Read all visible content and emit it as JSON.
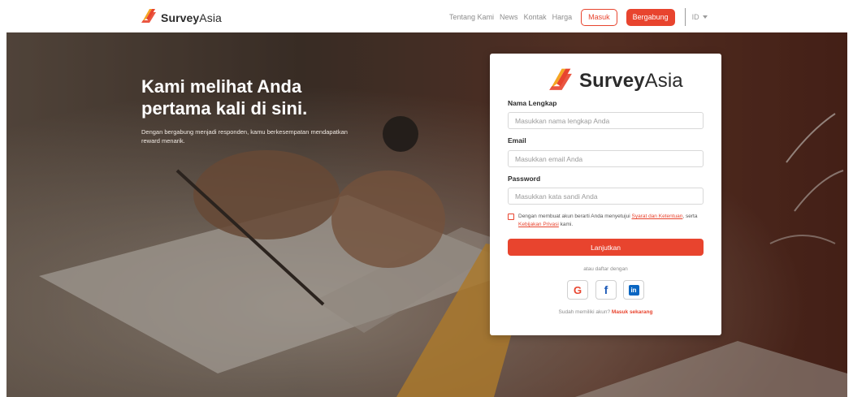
{
  "brand": {
    "name_bold": "Survey",
    "name_light": "Asia",
    "accent": "#e8442e"
  },
  "nav": {
    "links": [
      "Tentang Kami",
      "News",
      "Kontak",
      "Harga"
    ],
    "login_label": "Masuk",
    "join_label": "Bergabung",
    "language": "ID"
  },
  "hero": {
    "title_line1": "Kami melihat Anda",
    "title_line2": "pertama kali di sini.",
    "subtitle": "Dengan bergabung menjadi responden, kamu berkesempatan mendapatkan reward menarik."
  },
  "form": {
    "name_label": "Nama Lengkap",
    "name_placeholder": "Masukkan nama lengkap Anda",
    "email_label": "Email",
    "email_placeholder": "Masukkan email Anda",
    "password_label": "Password",
    "password_placeholder": "Masukkan kata sandi Anda",
    "terms_prefix": "Dengan membuat akun berarti Anda menyetujui",
    "terms_link": "Syarat dan Ketentuan",
    "terms_middle": ", serta",
    "privacy_link": "Kebijakan Privasi",
    "terms_suffix": "kami.",
    "submit_label": "Lanjutkan",
    "or_text": "atau daftar dengan",
    "social": [
      "G",
      "f",
      "in"
    ],
    "have_account": "Sudah memiliki akun?",
    "login_now": "Masuk sekarang"
  },
  "icons": {
    "logo": "surveyasia-logo-icon",
    "google": "google-icon",
    "facebook": "facebook-icon",
    "linkedin": "linkedin-icon",
    "caret": "chevron-down-icon"
  }
}
